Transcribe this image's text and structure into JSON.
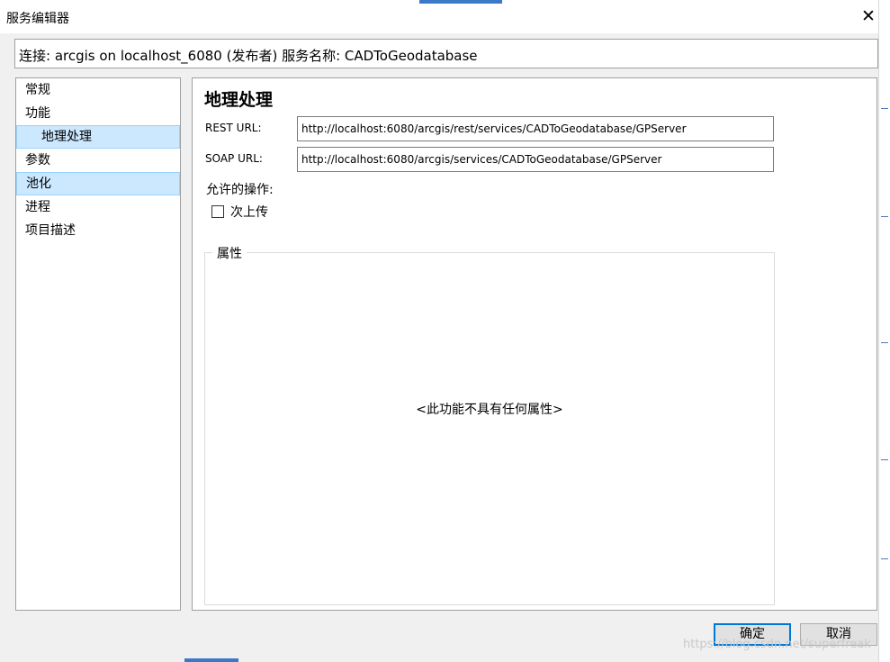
{
  "window": {
    "title": "服务编辑器"
  },
  "connection": {
    "text": "连接: arcgis on localhost_6080 (发布者)   服务名称: CADToGeodatabase"
  },
  "nav": {
    "items": [
      {
        "label": "常规"
      },
      {
        "label": "功能"
      },
      {
        "label": "地理处理"
      },
      {
        "label": "参数"
      },
      {
        "label": "池化"
      },
      {
        "label": "进程"
      },
      {
        "label": "项目描述"
      }
    ]
  },
  "content": {
    "heading": "地理处理",
    "rest_label": "REST URL:",
    "rest_url": "http://localhost:6080/arcgis/rest/services/CADToGeodatabase/GPServer",
    "soap_label": "SOAP URL:",
    "soap_url": "http://localhost:6080/arcgis/services/CADToGeodatabase/GPServer",
    "ops_label": "允许的操作:",
    "upload_label": "次上传",
    "upload_checked": false,
    "properties_title": "属性",
    "properties_message": "<此功能不具有任何属性>"
  },
  "buttons": {
    "ok": "确定",
    "cancel": "取消"
  },
  "watermark": "https://blog.csdn.net/superfreak",
  "colors": {
    "selection": "#cce8ff",
    "selection_border": "#99d1ff",
    "accent": "#0078d7"
  }
}
